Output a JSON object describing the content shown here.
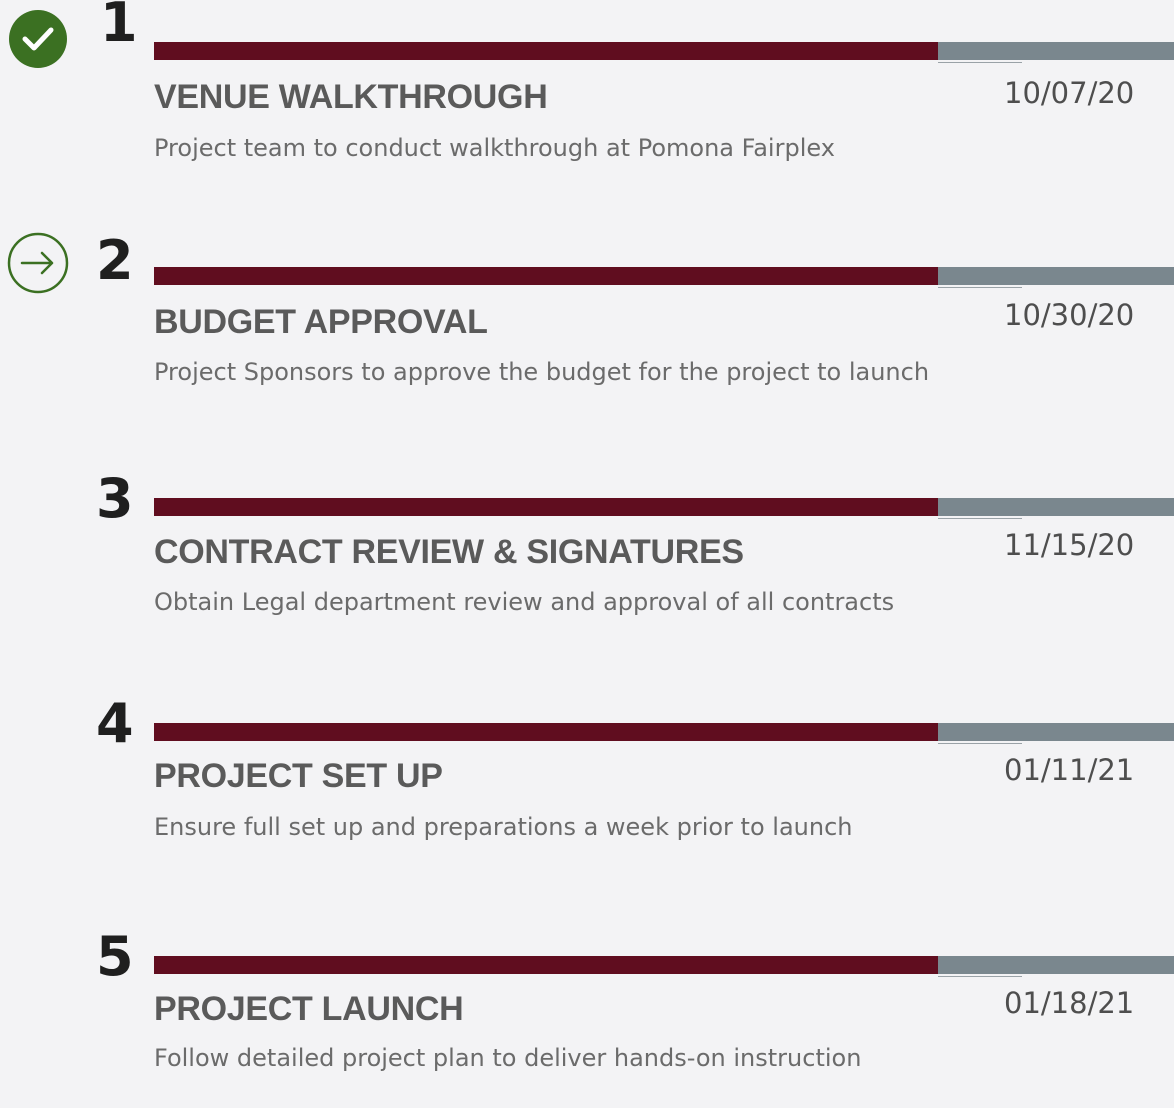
{
  "colors": {
    "bar_progress": "#600d1f",
    "bar_remaining": "#7a878e",
    "complete_icon": "#3b7022",
    "current_icon": "#3b7022",
    "background": "#f3f3f5"
  },
  "milestones": [
    {
      "number": "1",
      "status_icon": "check-circle-icon",
      "title": "VENUE WALKTHROUGH",
      "date": "10/07/20",
      "description": "Project team to conduct walkthrough at Pomona Fairplex"
    },
    {
      "number": "2",
      "status_icon": "arrow-right-circle-icon",
      "title": "BUDGET APPROVAL",
      "date": "10/30/20",
      "description": "Project Sponsors to approve the budget for the project to launch"
    },
    {
      "number": "3",
      "status_icon": "",
      "title": "CONTRACT REVIEW & SIGNATURES",
      "date": "11/15/20",
      "description": "Obtain Legal department review and approval of all contracts"
    },
    {
      "number": "4",
      "status_icon": "",
      "title": "PROJECT SET UP",
      "date": "01/11/21",
      "description": "Ensure full set up and preparations a week prior to launch"
    },
    {
      "number": "5",
      "status_icon": "",
      "title": "PROJECT LAUNCH",
      "date": "01/18/21",
      "description": "Follow detailed project plan to deliver hands-on instruction"
    }
  ]
}
